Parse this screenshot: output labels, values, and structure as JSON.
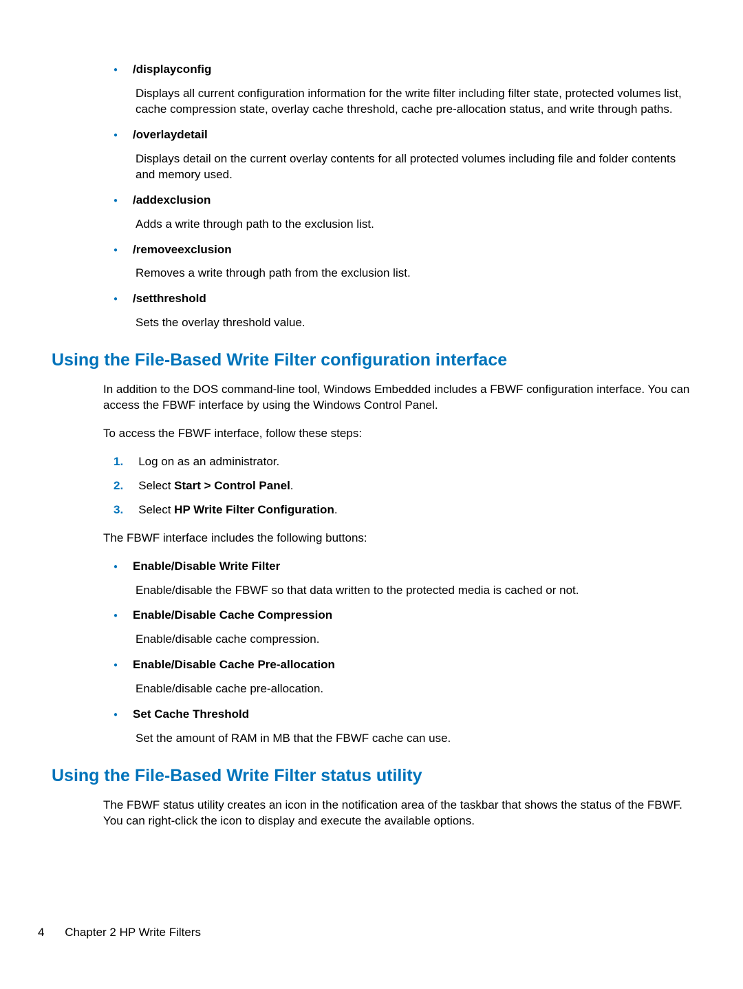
{
  "commands": [
    {
      "title": "/displayconfig",
      "desc": "Displays all current configuration information for the write filter including filter state, protected volumes list, cache compression state, overlay cache threshold, cache pre-allocation status, and write through paths."
    },
    {
      "title": "/overlaydetail",
      "desc": "Displays detail on the current overlay contents for all protected volumes including file and folder contents and memory used."
    },
    {
      "title": "/addexclusion",
      "desc": "Adds a write through path to the exclusion list."
    },
    {
      "title": "/removeexclusion",
      "desc": "Removes a write through path from the exclusion list."
    },
    {
      "title": "/setthreshold",
      "desc": "Sets the overlay threshold value."
    }
  ],
  "section1": {
    "heading": "Using the File-Based Write Filter configuration interface",
    "intro": "In addition to the DOS command-line tool, Windows Embedded includes a FBWF configuration interface. You can access the FBWF interface by using the Windows Control Panel.",
    "access": "To access the FBWF interface, follow these steps:",
    "steps": {
      "step1": "Log on as an administrator.",
      "step2_prefix": "Select ",
      "step2_bold": "Start > Control Panel",
      "step2_suffix": ".",
      "step3_prefix": "Select ",
      "step3_bold": "HP Write Filter Configuration",
      "step3_suffix": "."
    },
    "buttons_intro": "The FBWF interface includes the following buttons:",
    "buttons": [
      {
        "title": "Enable/Disable Write Filter",
        "desc": "Enable/disable the FBWF so that data written to the protected media is cached or not."
      },
      {
        "title": "Enable/Disable Cache Compression",
        "desc": "Enable/disable cache compression."
      },
      {
        "title": "Enable/Disable Cache Pre-allocation",
        "desc": "Enable/disable cache pre-allocation."
      },
      {
        "title": "Set Cache Threshold",
        "desc": "Set the amount of RAM in MB that the FBWF cache can use."
      }
    ]
  },
  "section2": {
    "heading": "Using the File-Based Write Filter status utility",
    "para": "The FBWF status utility creates an icon in the notification area of the taskbar that shows the status of the FBWF. You can right-click the icon to display and execute the available options."
  },
  "footer": {
    "page": "4",
    "chapter": "Chapter 2   HP Write Filters"
  },
  "numbers": {
    "n1": "1.",
    "n2": "2.",
    "n3": "3."
  }
}
